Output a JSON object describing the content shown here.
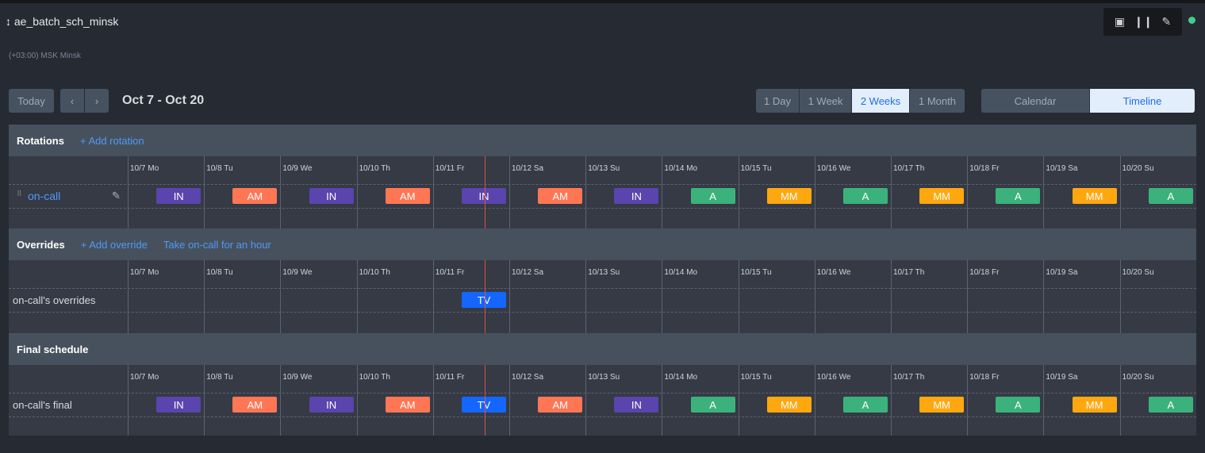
{
  "header": {
    "title": "ae_batch_sch_minsk",
    "title_icon": "sort-arrows-icon",
    "timezone": "(+03:00) MSK Minsk",
    "tools": [
      "calendar-icon",
      "pause-icon",
      "edit-icon"
    ],
    "status_color": "#3fcf8e"
  },
  "nav": {
    "today": "Today",
    "prev": "‹",
    "next": "›",
    "range": "Oct 7 - Oct 20"
  },
  "ranges": [
    {
      "label": "1 Day",
      "active": false
    },
    {
      "label": "1 Week",
      "active": false
    },
    {
      "label": "2 Weeks",
      "active": true
    },
    {
      "label": "1 Month",
      "active": false
    }
  ],
  "views": [
    {
      "label": "Calendar",
      "active": false
    },
    {
      "label": "Timeline",
      "active": true
    }
  ],
  "days": [
    "10/7 Mo",
    "10/8 Tu",
    "10/9 We",
    "10/10 Th",
    "10/11 Fr",
    "10/12 Sa",
    "10/13 Su",
    "10/14 Mo",
    "10/15 Tu",
    "10/16 We",
    "10/17 Th",
    "10/18 Fr",
    "10/19 Sa",
    "10/20 Su"
  ],
  "colors": {
    "IN": "#5a44ad",
    "AM": "#ff7654",
    "A": "#3bb27b",
    "MM": "#ffa70f",
    "TV": "#1566ff"
  },
  "sections": [
    {
      "title": "Rotations",
      "links": [
        "+ Add rotation"
      ],
      "row_label": "on-call",
      "row_is_link": true,
      "badges": [
        "IN",
        "AM",
        "IN",
        "AM",
        "IN",
        "AM",
        "IN",
        "A",
        "MM",
        "A",
        "MM",
        "A",
        "MM",
        "A"
      ]
    },
    {
      "title": "Overrides",
      "links": [
        "+ Add override",
        "Take on-call for an hour"
      ],
      "row_label": "on-call's overrides",
      "row_is_link": false,
      "badges": [
        null,
        null,
        null,
        null,
        "TV",
        null,
        null,
        null,
        null,
        null,
        null,
        null,
        null,
        null
      ]
    },
    {
      "title": "Final schedule",
      "links": [],
      "row_label": "on-call's final",
      "row_is_link": false,
      "badges": [
        "IN",
        "AM",
        "IN",
        "AM",
        "TV",
        "AM",
        "IN",
        "A",
        "MM",
        "A",
        "MM",
        "A",
        "MM",
        "A"
      ]
    }
  ]
}
